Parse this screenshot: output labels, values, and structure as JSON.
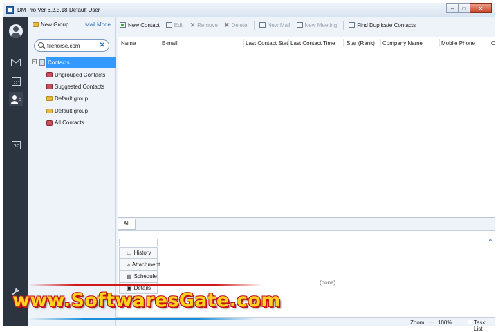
{
  "window": {
    "title": "DM Pro Ver 6.2.5.18",
    "user": "Default User",
    "controls": [
      "–",
      "□",
      "✕"
    ]
  },
  "rail": {
    "items": [
      "avatar",
      "mail-icon",
      "calendar-icon",
      "contacts-icon",
      "calendar-30-icon",
      "wrench-icon"
    ]
  },
  "leftpane": {
    "new_group": "New Group",
    "mail_mode": "Mail Mode",
    "search_value": "filehorse.com",
    "root_label": "Contacts",
    "items": [
      {
        "label": "Ungrouped Contacts",
        "icon": "group-icon"
      },
      {
        "label": "Suggested Contacts",
        "icon": "group-icon"
      },
      {
        "label": "Default group",
        "icon": "folder-icon"
      },
      {
        "label": "Default group",
        "icon": "folder-icon"
      },
      {
        "label": "All Contacts",
        "icon": "group-icon"
      }
    ]
  },
  "toolbar": {
    "new_contact": "New Contact",
    "edit": "Edit",
    "remove": "Remove",
    "delete": "Delete",
    "new_mail": "New Mail",
    "new_meeting": "New Meeting",
    "find_duplicates": "Find Duplicate Contacts"
  },
  "grid": {
    "columns": [
      "Name",
      "E-mail",
      "Last Contact Status",
      "Last Contact Time",
      "Star (Rank)",
      "Company Name",
      "Mobile Phone",
      "O"
    ]
  },
  "tabs": {
    "all": "All"
  },
  "detail": {
    "tabs": [
      "History",
      "Attachment",
      "Schedule",
      "Details"
    ],
    "empty": "(none)"
  },
  "statusbar": {
    "zoom_label": "Zoom",
    "zoom_value": "100%",
    "task_list": "Task List"
  },
  "watermark": {
    "text": "www.SoftwaresGate.com"
  },
  "colors": {
    "rail": "#2c3440",
    "selection": "#3399ff",
    "accent": "#2a6db3",
    "watermark_fill": "#ffd21f",
    "watermark_stroke": "#c0141a"
  }
}
